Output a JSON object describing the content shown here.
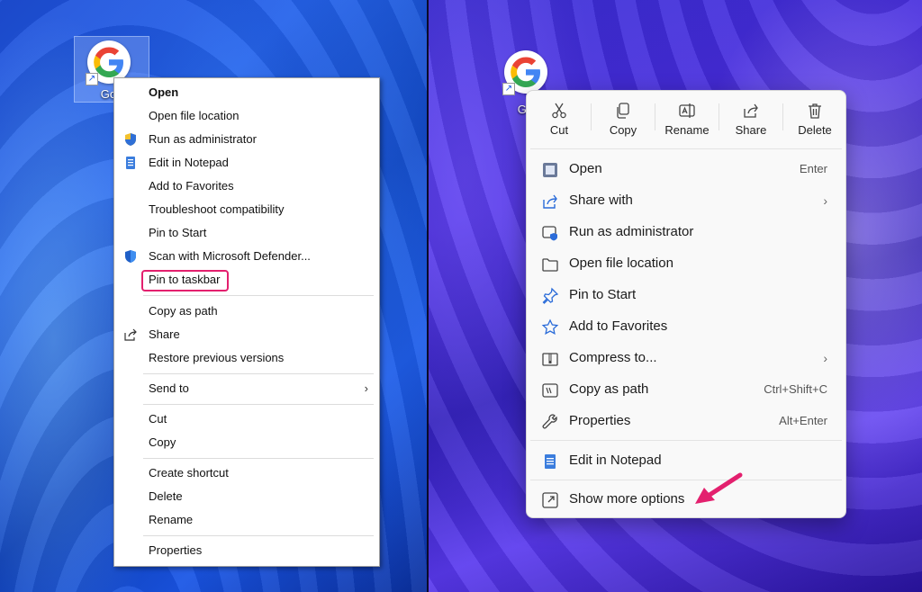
{
  "left": {
    "desktop_icon_label": "Goo",
    "classic_menu": {
      "items": [
        {
          "label": "Open"
        },
        {
          "label": "Open file location"
        },
        {
          "label": "Run as administrator"
        },
        {
          "label": "Edit in Notepad"
        },
        {
          "label": "Add to Favorites"
        },
        {
          "label": "Troubleshoot compatibility"
        },
        {
          "label": "Pin to Start"
        },
        {
          "label": "Scan with Microsoft Defender..."
        },
        {
          "label": "Pin to taskbar"
        },
        {
          "label": "Copy as path"
        },
        {
          "label": "Share"
        },
        {
          "label": "Restore previous versions"
        },
        {
          "label": "Send to"
        },
        {
          "label": "Cut"
        },
        {
          "label": "Copy"
        },
        {
          "label": "Create shortcut"
        },
        {
          "label": "Delete"
        },
        {
          "label": "Rename"
        },
        {
          "label": "Properties"
        }
      ],
      "highlight_color": "#e3206e"
    }
  },
  "right": {
    "desktop_icon_label": "Goo",
    "modern_menu": {
      "toolbar": [
        {
          "label": "Cut",
          "icon": "scissors-icon"
        },
        {
          "label": "Copy",
          "icon": "copy-icon"
        },
        {
          "label": "Rename",
          "icon": "rename-icon"
        },
        {
          "label": "Share",
          "icon": "share-icon"
        },
        {
          "label": "Delete",
          "icon": "trash-icon"
        }
      ],
      "items": [
        {
          "label": "Open",
          "shortcut": "Enter"
        },
        {
          "label": "Share with",
          "shortcut": ""
        },
        {
          "label": "Run as administrator",
          "shortcut": ""
        },
        {
          "label": "Open file location",
          "shortcut": ""
        },
        {
          "label": "Pin to Start",
          "shortcut": ""
        },
        {
          "label": "Add to Favorites",
          "shortcut": ""
        },
        {
          "label": "Compress to...",
          "shortcut": ""
        },
        {
          "label": "Copy as path",
          "shortcut": "Ctrl+Shift+C"
        },
        {
          "label": "Properties",
          "shortcut": "Alt+Enter"
        },
        {
          "label": "Edit in Notepad",
          "shortcut": ""
        },
        {
          "label": "Show more options",
          "shortcut": ""
        }
      ],
      "arrow_color": "#e3206e",
      "accent_color": "#2b6cd9"
    }
  }
}
